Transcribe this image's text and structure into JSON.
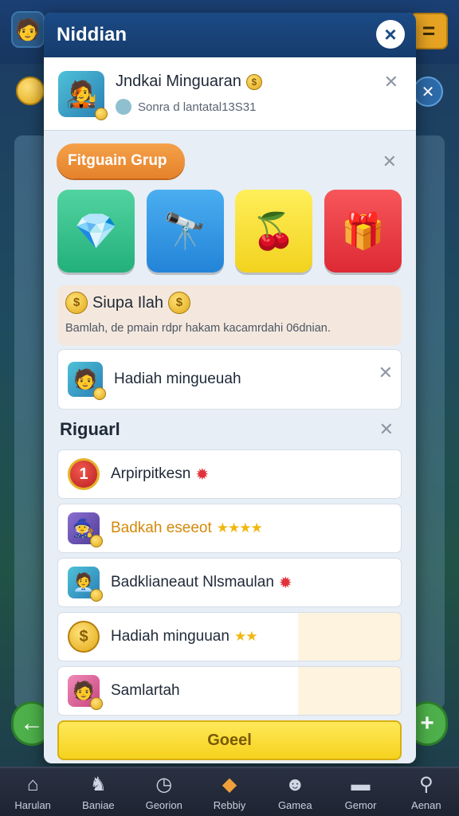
{
  "modal": {
    "title": "Niddian",
    "close_icon": "×"
  },
  "profile": {
    "name": "Jndkai Minguaran",
    "id_text": "Sonra d lantatal13S31"
  },
  "group": {
    "pill_label": "Fitguain Grup",
    "tiles": [
      {
        "name": "gem-tile",
        "icon": "💎"
      },
      {
        "name": "telescope-tile",
        "icon": "🔭"
      },
      {
        "name": "cherry-tile",
        "icon": "🍒"
      },
      {
        "name": "gift-tile",
        "icon": "🎁"
      }
    ]
  },
  "promo": {
    "title": "Siupa Ilah",
    "description": "Bamlah, de pmain rdpr hakam kacamrdahi 06dnian."
  },
  "reward_card": {
    "label": "Hadiah mingueuah"
  },
  "section": {
    "title": "Riguarl"
  },
  "list": [
    {
      "label": "Arpirpitkesn",
      "suffix": "gem"
    },
    {
      "label": "Badkah eseeot",
      "suffix": "stars4"
    },
    {
      "label": "Badklianeaut Nlsmaulan",
      "suffix": "gem"
    },
    {
      "label": "Hadiah minguuan",
      "suffix": "stars2"
    },
    {
      "label": "Samlartah",
      "suffix": ""
    }
  ],
  "cta": {
    "label": "Goeel"
  },
  "bottom_nav": [
    {
      "label": "Harulan",
      "icon": "⌂"
    },
    {
      "label": "Baniae",
      "icon": "♞"
    },
    {
      "label": "Georion",
      "icon": "◷"
    },
    {
      "label": "Rebbiy",
      "icon": "◆"
    },
    {
      "label": "Gamea",
      "icon": "☻"
    },
    {
      "label": "Gemor",
      "icon": "▬"
    },
    {
      "label": "Aenan",
      "icon": "⚲"
    }
  ],
  "colors": {
    "header": "#1b4a85",
    "cta": "#f6d21d",
    "pill": "#e5822a"
  }
}
